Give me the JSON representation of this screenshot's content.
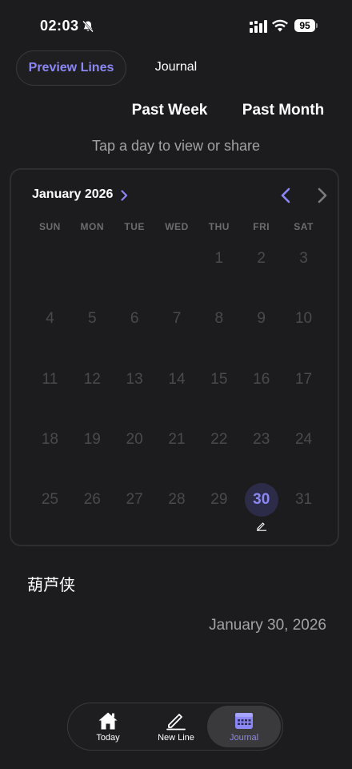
{
  "status_bar": {
    "time": "02:03",
    "battery": "95"
  },
  "tabs": {
    "preview_lines": "Preview Lines",
    "journal": "Journal"
  },
  "filters": {
    "past_week": "Past Week",
    "past_month": "Past Month"
  },
  "hint": "Tap a day to view or share",
  "calendar": {
    "month_title": "January 2026",
    "weekdays": [
      "SUN",
      "MON",
      "TUE",
      "WED",
      "THU",
      "FRI",
      "SAT"
    ],
    "leading_blanks": 4,
    "days": [
      "1",
      "2",
      "3",
      "4",
      "5",
      "6",
      "7",
      "8",
      "9",
      "10",
      "11",
      "12",
      "13",
      "14",
      "15",
      "16",
      "17",
      "18",
      "19",
      "20",
      "21",
      "22",
      "23",
      "24",
      "25",
      "26",
      "27",
      "28",
      "29",
      "30",
      "31"
    ],
    "selected_day": "30",
    "days_with_entries": [
      "30"
    ]
  },
  "entry": {
    "text": "葫芦侠",
    "date": "January 30, 2026"
  },
  "bottom_nav": {
    "today": "Today",
    "new_line": "New Line",
    "journal": "Journal"
  },
  "colors": {
    "accent": "#8b87f5",
    "background": "#1c1c1e",
    "muted_day": "#4a4a4e",
    "selected_bg": "#2c2c48"
  }
}
